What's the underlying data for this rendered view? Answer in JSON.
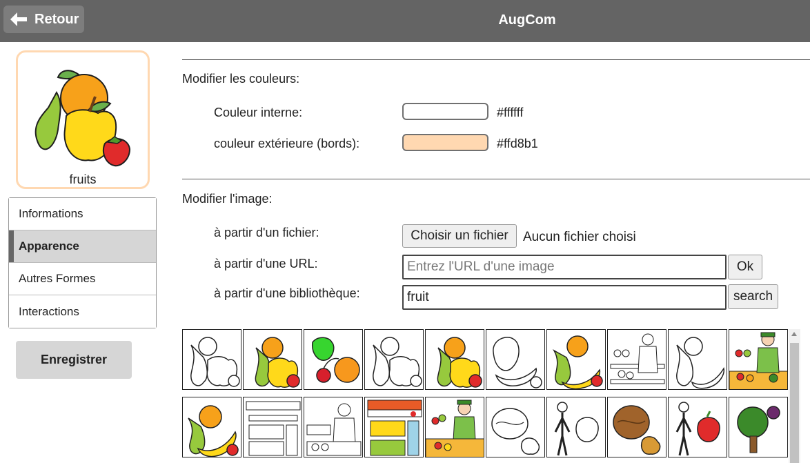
{
  "header": {
    "back_label": "Retour",
    "title": "AugCom"
  },
  "preview": {
    "label": "fruits",
    "inner_color": "#ffffff",
    "border_color": "#ffd8b1"
  },
  "sidebar": {
    "items": [
      {
        "label": "Informations"
      },
      {
        "label": "Apparence"
      },
      {
        "label": "Autres Formes"
      },
      {
        "label": "Interactions"
      }
    ],
    "active": "Apparence",
    "save_label": "Enregistrer"
  },
  "colors_section": {
    "title": "Modifier les couleurs:",
    "inner_label": "Couleur interne:",
    "inner_value": "#ffffff",
    "outer_label": "couleur extérieure (bords):",
    "outer_value": "#ffd8b1"
  },
  "image_section": {
    "title": "Modifier l'image:",
    "file_label": "à partir d'un fichier:",
    "file_button": "Choisir un fichier",
    "file_status": "Aucun fichier choisi",
    "url_label": "à partir d'une URL:",
    "url_placeholder": "Entrez l'URL d'une image",
    "url_value": "",
    "url_button": "Ok",
    "library_label": "à partir d'une bibliothèque:",
    "library_value": "fruit",
    "library_button": "search"
  },
  "results": [
    {
      "icon": "fruits-outline-icon"
    },
    {
      "icon": "fruits-color-icon"
    },
    {
      "icon": "apple-cherries-orange-icon"
    },
    {
      "icon": "fruits-outline-icon"
    },
    {
      "icon": "fruits-color-icon"
    },
    {
      "icon": "fruits-banana-outline-icon"
    },
    {
      "icon": "fruits-banana-color-icon"
    },
    {
      "icon": "fruit-seller-outline-icon"
    },
    {
      "icon": "fruits-banana-outline-icon"
    },
    {
      "icon": "fruit-seller-color-icon"
    },
    {
      "icon": "pear-orange-banana-icon"
    },
    {
      "icon": "fruit-shop-outline-icon"
    },
    {
      "icon": "fruit-seller-woman-outline-icon"
    },
    {
      "icon": "fruit-shop-color-icon"
    },
    {
      "icon": "fruit-seller-woman-color-icon"
    },
    {
      "icon": "walnut-outline-icon"
    },
    {
      "icon": "person-apple-outline-icon"
    },
    {
      "icon": "walnut-color-icon"
    },
    {
      "icon": "person-apple-color-icon"
    },
    {
      "icon": "fruit-tree-icon"
    }
  ]
}
